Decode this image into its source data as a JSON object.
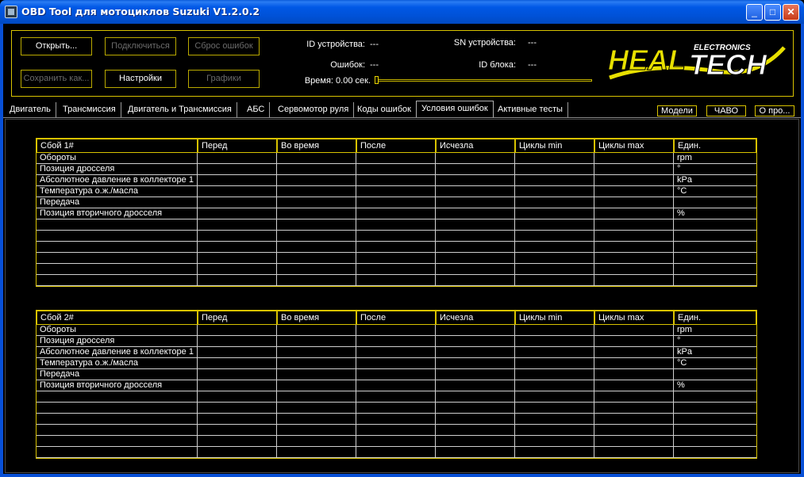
{
  "window": {
    "title": "OBD Tool для мотоциклов Suzuki V1.2.0.2",
    "controls": {
      "minimize": "_",
      "maximize": "□",
      "close": "✕"
    }
  },
  "panel": {
    "buttons": {
      "open": "Открыть...",
      "connect": "Подключиться",
      "reset_errors": "Сброс ошибок",
      "save_as": "Сохранить как...",
      "settings": "Настройки",
      "graphs": "Графики"
    },
    "info": {
      "device_id_label": "ID устройства:",
      "device_id_value": "---",
      "errors_label": "Ошибок:",
      "errors_value": "---",
      "time_label": "Время: 0.00 сек.",
      "sn_label": "SN устройства:",
      "sn_value": "---",
      "block_id_label": "ID блока:",
      "block_id_value": "---"
    },
    "logo": {
      "main_left": "HEAL",
      "main_right": "TECH",
      "sub": "ELECTRONICS"
    }
  },
  "tabs": [
    "Двигатель",
    "Трансмиссия",
    "Двигатель и Трансмиссия",
    "АБС",
    "Сервомотор руля",
    "Коды ошибок",
    "Условия ошибок",
    "Активные тесты"
  ],
  "active_tab": "Условия ошибок",
  "right_buttons": {
    "models": "Модели",
    "faq": "ЧАВО",
    "about": "О про..."
  },
  "table1": {
    "headers": [
      "Сбой 1#",
      "Перед",
      "Во время",
      "После",
      "Исчезла",
      "Циклы min",
      "Циклы max",
      "Един."
    ],
    "rows": [
      [
        "Обороты",
        "",
        "",
        "",
        "",
        "",
        "",
        "rpm"
      ],
      [
        "Позиция дросселя",
        "",
        "",
        "",
        "",
        "",
        "",
        "°"
      ],
      [
        "Абсолютное давление в коллекторе 1",
        "",
        "",
        "",
        "",
        "",
        "",
        "kPa"
      ],
      [
        "Температура о.ж./масла",
        "",
        "",
        "",
        "",
        "",
        "",
        "°C"
      ],
      [
        "Передача",
        "",
        "",
        "",
        "",
        "",
        "",
        ""
      ],
      [
        "Позиция вторичного дросселя",
        "",
        "",
        "",
        "",
        "",
        "",
        "%"
      ],
      [
        "",
        "",
        "",
        "",
        "",
        "",
        "",
        ""
      ],
      [
        "",
        "",
        "",
        "",
        "",
        "",
        "",
        ""
      ],
      [
        "",
        "",
        "",
        "",
        "",
        "",
        "",
        ""
      ],
      [
        "",
        "",
        "",
        "",
        "",
        "",
        "",
        ""
      ],
      [
        "",
        "",
        "",
        "",
        "",
        "",
        "",
        ""
      ],
      [
        "",
        "",
        "",
        "",
        "",
        "",
        "",
        ""
      ]
    ]
  },
  "table2": {
    "headers": [
      "Сбой 2#",
      "Перед",
      "Во время",
      "После",
      "Исчезла",
      "Циклы min",
      "Циклы max",
      "Един."
    ],
    "rows": [
      [
        "Обороты",
        "",
        "",
        "",
        "",
        "",
        "",
        "rpm"
      ],
      [
        "Позиция дросселя",
        "",
        "",
        "",
        "",
        "",
        "",
        "°"
      ],
      [
        "Абсолютное давление в коллекторе 1",
        "",
        "",
        "",
        "",
        "",
        "",
        "kPa"
      ],
      [
        "Температура о.ж./масла",
        "",
        "",
        "",
        "",
        "",
        "",
        "°C"
      ],
      [
        "Передача",
        "",
        "",
        "",
        "",
        "",
        "",
        ""
      ],
      [
        "Позиция вторичного дросселя",
        "",
        "",
        "",
        "",
        "",
        "",
        "%"
      ],
      [
        "",
        "",
        "",
        "",
        "",
        "",
        "",
        ""
      ],
      [
        "",
        "",
        "",
        "",
        "",
        "",
        "",
        ""
      ],
      [
        "",
        "",
        "",
        "",
        "",
        "",
        "",
        ""
      ],
      [
        "",
        "",
        "",
        "",
        "",
        "",
        "",
        ""
      ],
      [
        "",
        "",
        "",
        "",
        "",
        "",
        "",
        ""
      ],
      [
        "",
        "",
        "",
        "",
        "",
        "",
        "",
        ""
      ]
    ]
  }
}
